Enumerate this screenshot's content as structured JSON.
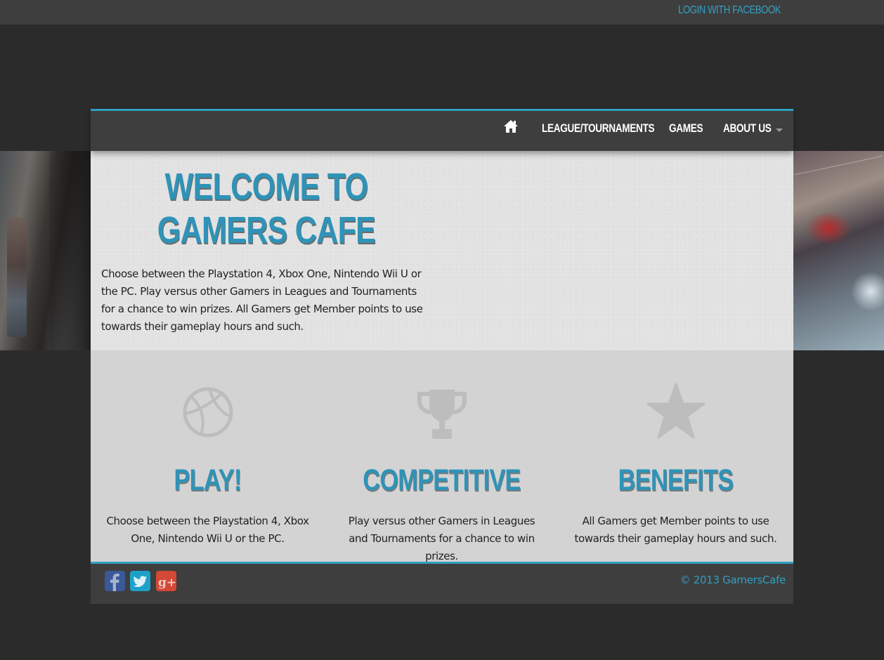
{
  "topbar": {
    "login_label": "LOGIN WITH FACEBOOK"
  },
  "nav": {
    "home_icon": "home-icon",
    "items": [
      {
        "label": "LEAGUE/TOURNAMENTS"
      },
      {
        "label": "GAMES"
      },
      {
        "label": "ABOUT US"
      }
    ]
  },
  "welcome": {
    "title": "WELCOME TO GAMERS CAFE",
    "text": "Choose between the Playstation 4, Xbox One, Nintendo Wii U or the PC. Play versus other Gamers in Leagues and Tournaments for a chance to win prizes. All Gamers get Member points to use towards their gameplay hours and such."
  },
  "features": [
    {
      "icon": "basketball-icon",
      "title": "PLAY!",
      "text": "Choose between the Playstation 4, Xbox One, Nintendo Wii U or the PC."
    },
    {
      "icon": "trophy-icon",
      "title": "COMPETITIVE",
      "text": "Play versus other Gamers in Leagues and Tournaments for a chance to win prizes."
    },
    {
      "icon": "star-icon",
      "title": "BENEFITS",
      "text": "All Gamers get Member points to use towards their gameplay hours and such."
    }
  ],
  "footer": {
    "social": [
      {
        "icon": "facebook-icon",
        "color": "#3b5998"
      },
      {
        "icon": "twitter-icon",
        "color": "#1da1c8"
      },
      {
        "icon": "google-plus-icon",
        "color": "#d34836"
      }
    ],
    "copyright": "© 2013 GamersCafe"
  },
  "colors": {
    "accent": "#2fa0c2",
    "bar": "#3e3e3e",
    "page_bg": "#2b2b2b"
  }
}
